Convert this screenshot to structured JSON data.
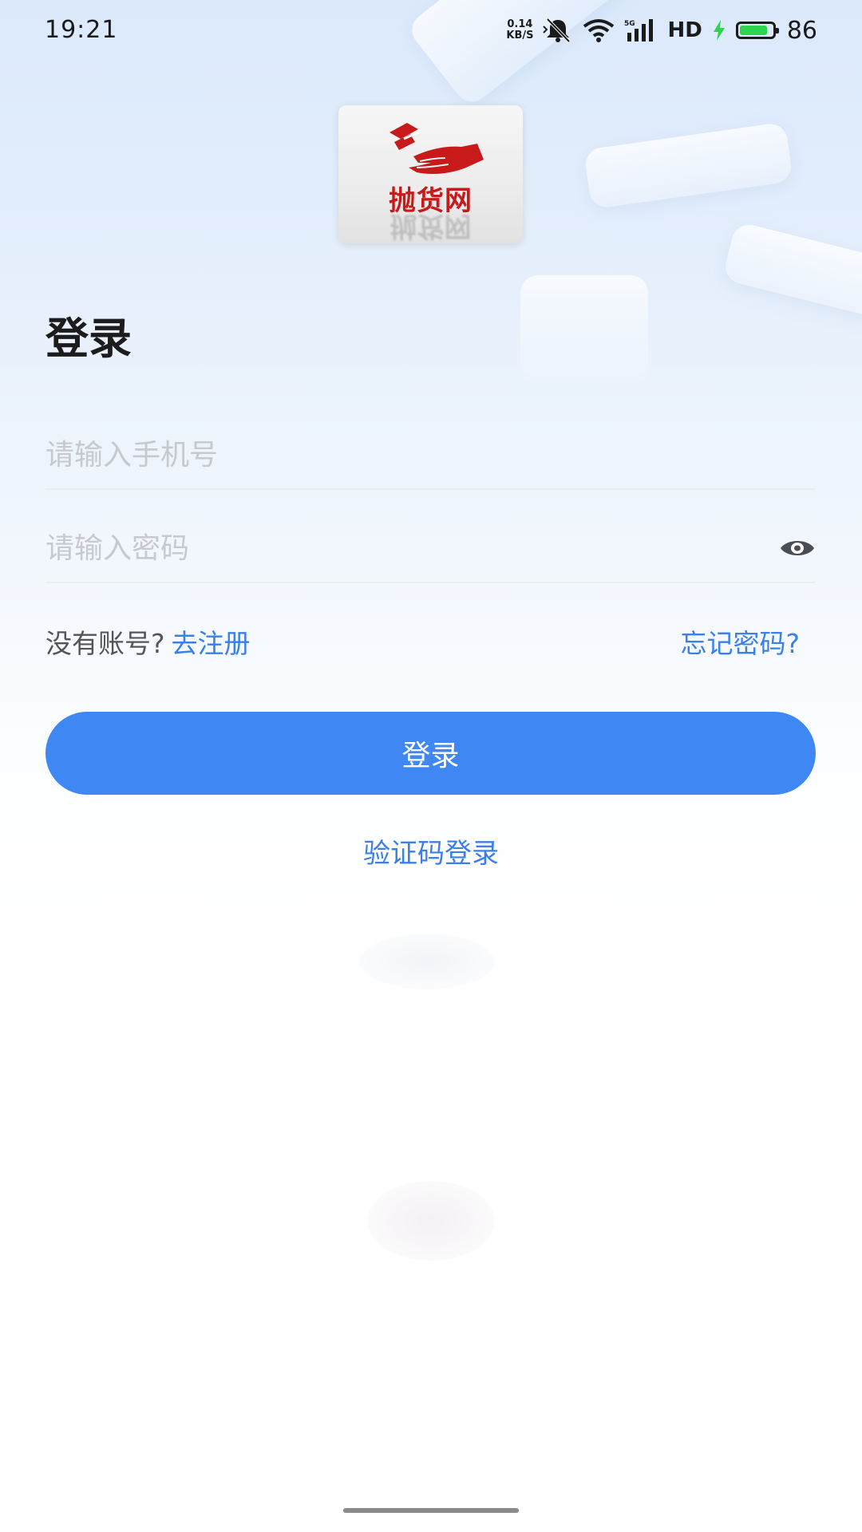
{
  "status_bar": {
    "time": "19:21",
    "net_speed_value": "0.14",
    "net_speed_unit": "KB/S",
    "hd_label": "HD",
    "battery_percent": "86",
    "battery_level": 0.86
  },
  "logo": {
    "text": "抛货网",
    "brand_color": "#c81a1a"
  },
  "page": {
    "title": "登录"
  },
  "form": {
    "phone_placeholder": "请输入手机号",
    "password_placeholder": "请输入密码",
    "phone_value": "",
    "password_value": ""
  },
  "links": {
    "no_account": "没有账号?",
    "register": "去注册",
    "forgot_password": "忘记密码?"
  },
  "actions": {
    "login_label": "登录",
    "code_login_label": "验证码登录"
  },
  "colors": {
    "accent": "#3f87f2",
    "link": "#3a80e8",
    "placeholder": "#c7c9ce"
  },
  "icons": {
    "password_toggle": "eye-icon",
    "signal": "signal-icon",
    "wifi": "wifi-icon",
    "mute": "bell-mute-icon",
    "charging": "bolt-icon",
    "battery": "battery-icon"
  }
}
